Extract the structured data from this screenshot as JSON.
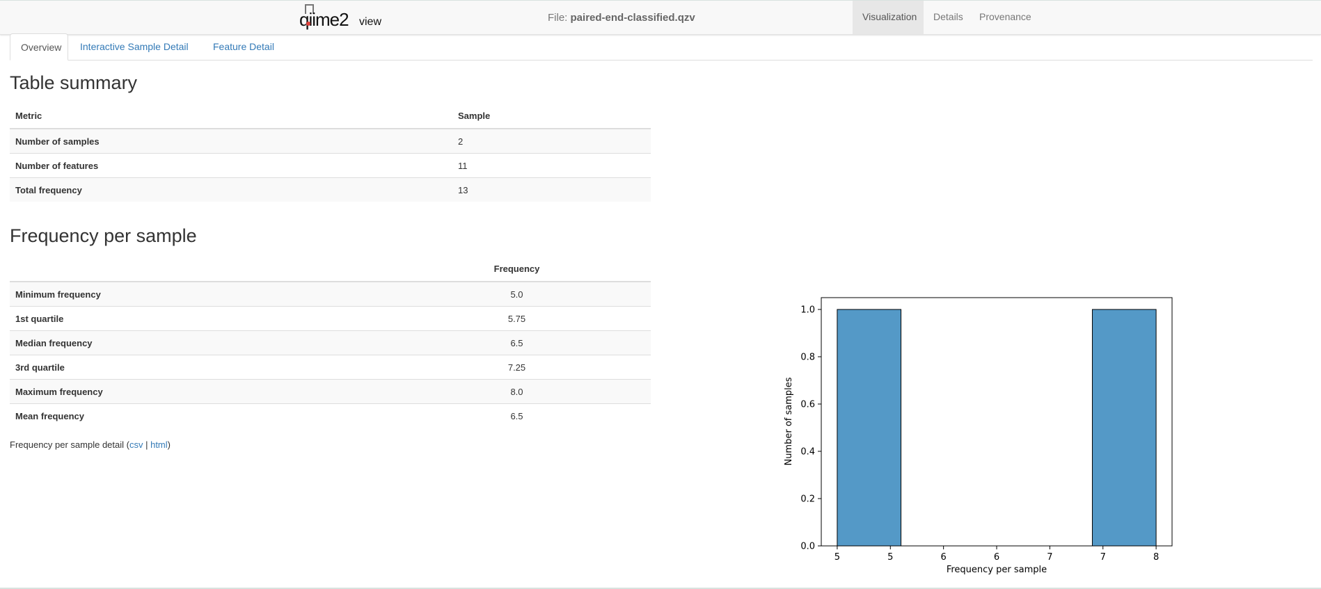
{
  "header": {
    "logo_text": "qiime2view",
    "file_label": "File:",
    "file_name": "paired-end-classified.qzv",
    "nav": [
      {
        "label": "Visualization",
        "active": true
      },
      {
        "label": "Details",
        "active": false
      },
      {
        "label": "Provenance",
        "active": false
      }
    ]
  },
  "tabs": [
    {
      "label": "Overview",
      "active": true
    },
    {
      "label": "Interactive Sample Detail",
      "active": false
    },
    {
      "label": "Feature Detail",
      "active": false
    }
  ],
  "table_summary": {
    "heading": "Table summary",
    "columns": [
      "Metric",
      "Sample"
    ],
    "rows": [
      {
        "metric": "Number of samples",
        "value": "2"
      },
      {
        "metric": "Number of features",
        "value": "11"
      },
      {
        "metric": "Total frequency",
        "value": "13"
      }
    ]
  },
  "frequency_per_sample": {
    "heading": "Frequency per sample",
    "columns": [
      "",
      "Frequency"
    ],
    "rows": [
      {
        "metric": "Minimum frequency",
        "value": "5.0"
      },
      {
        "metric": "1st quartile",
        "value": "5.75"
      },
      {
        "metric": "Median frequency",
        "value": "6.5"
      },
      {
        "metric": "3rd quartile",
        "value": "7.25"
      },
      {
        "metric": "Maximum frequency",
        "value": "8.0"
      },
      {
        "metric": "Mean frequency",
        "value": "6.5"
      }
    ],
    "detail_text": "Frequency per sample detail (",
    "csv_link": "csv",
    "separator": " | ",
    "html_link": "html",
    "detail_close": ")"
  },
  "chart_data": {
    "type": "bar",
    "title": "",
    "xlabel": "Frequency per sample",
    "ylabel": "Number of samples",
    "bins": [
      {
        "x0": 5.0,
        "x1": 5.6,
        "value": 1.0
      },
      {
        "x0": 5.6,
        "x1": 6.2,
        "value": 0.0
      },
      {
        "x0": 6.2,
        "x1": 6.8,
        "value": 0.0
      },
      {
        "x0": 6.8,
        "x1": 7.4,
        "value": 0.0
      },
      {
        "x0": 7.4,
        "x1": 8.0,
        "value": 1.0
      }
    ],
    "xlim": [
      4.85,
      8.15
    ],
    "ylim": [
      0,
      1.05
    ],
    "xticks": [
      {
        "value": 5.0,
        "label": "5"
      },
      {
        "value": 5.5,
        "label": "5"
      },
      {
        "value": 6.0,
        "label": "6"
      },
      {
        "value": 6.5,
        "label": "6"
      },
      {
        "value": 7.0,
        "label": "7"
      },
      {
        "value": 7.5,
        "label": "7"
      },
      {
        "value": 8.0,
        "label": "8"
      }
    ],
    "yticks": [
      {
        "value": 0.0,
        "label": "0.0"
      },
      {
        "value": 0.2,
        "label": "0.2"
      },
      {
        "value": 0.4,
        "label": "0.4"
      },
      {
        "value": 0.6,
        "label": "0.6"
      },
      {
        "value": 0.8,
        "label": "0.8"
      },
      {
        "value": 1.0,
        "label": "1.0"
      }
    ],
    "bar_color": "#5499c7",
    "edge_color": "#000000",
    "grid": false
  }
}
